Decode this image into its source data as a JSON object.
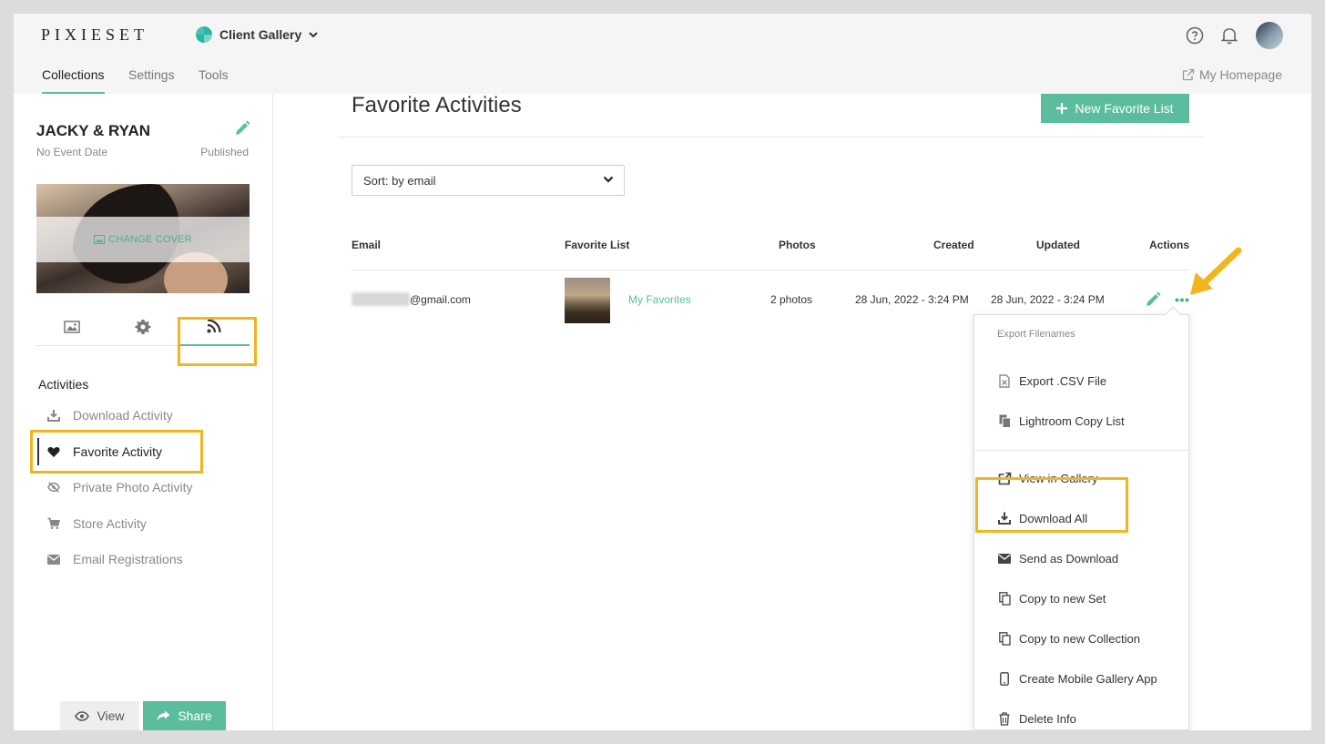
{
  "topbar": {
    "logo": "PIXIESET",
    "app_switcher": "Client Gallery"
  },
  "nav": {
    "tabs": [
      "Collections",
      "Settings",
      "Tools"
    ],
    "active_tab": "Collections",
    "homepage_link": "My Homepage"
  },
  "sidebar": {
    "collection_title": "JACKY & RYAN",
    "event_date": "No Event Date",
    "status": "Published",
    "change_cover": "CHANGE COVER",
    "activities_heading": "Activities",
    "activities": [
      {
        "label": "Download Activity",
        "icon": "download-icon"
      },
      {
        "label": "Favorite Activity",
        "icon": "heart-icon"
      },
      {
        "label": "Private Photo Activity",
        "icon": "eye-slash-icon"
      },
      {
        "label": "Store Activity",
        "icon": "cart-icon"
      },
      {
        "label": "Email Registrations",
        "icon": "envelope-icon"
      }
    ],
    "view_button": "View",
    "share_button": "Share"
  },
  "main": {
    "title": "Favorite Activities",
    "new_list_button": "New Favorite List",
    "sort_select": "Sort: by email",
    "table": {
      "columns": [
        "Email",
        "Favorite List",
        "Photos",
        "Created",
        "Updated",
        "Actions"
      ],
      "rows": [
        {
          "email": "@gmail.com",
          "favorite_list": "My Favorites",
          "photos": "2 photos",
          "created": "28 Jun, 2022 - 3:24 PM",
          "updated": "28 Jun, 2022 - 3:24 PM"
        }
      ]
    }
  },
  "action_menu": {
    "heading": "Export Filenames",
    "export_items": [
      {
        "label": "Export .CSV File",
        "icon": "csv-file-icon"
      },
      {
        "label": "Lightroom Copy List",
        "icon": "copy-files-icon"
      }
    ],
    "items": [
      {
        "label": "View in Gallery",
        "icon": "external-link-icon"
      },
      {
        "label": "Download All",
        "icon": "download-icon"
      },
      {
        "label": "Send as Download",
        "icon": "envelope-icon"
      },
      {
        "label": "Copy to new Set",
        "icon": "copy-icon"
      },
      {
        "label": "Copy to new Collection",
        "icon": "copy-icon"
      },
      {
        "label": "Create Mobile Gallery App",
        "icon": "mobile-icon"
      },
      {
        "label": "Delete Info",
        "icon": "trash-icon"
      }
    ]
  },
  "colors": {
    "accent": "#5bbd9e",
    "highlight": "#f2b51d",
    "topbar_bg": "#f5f5f5"
  }
}
